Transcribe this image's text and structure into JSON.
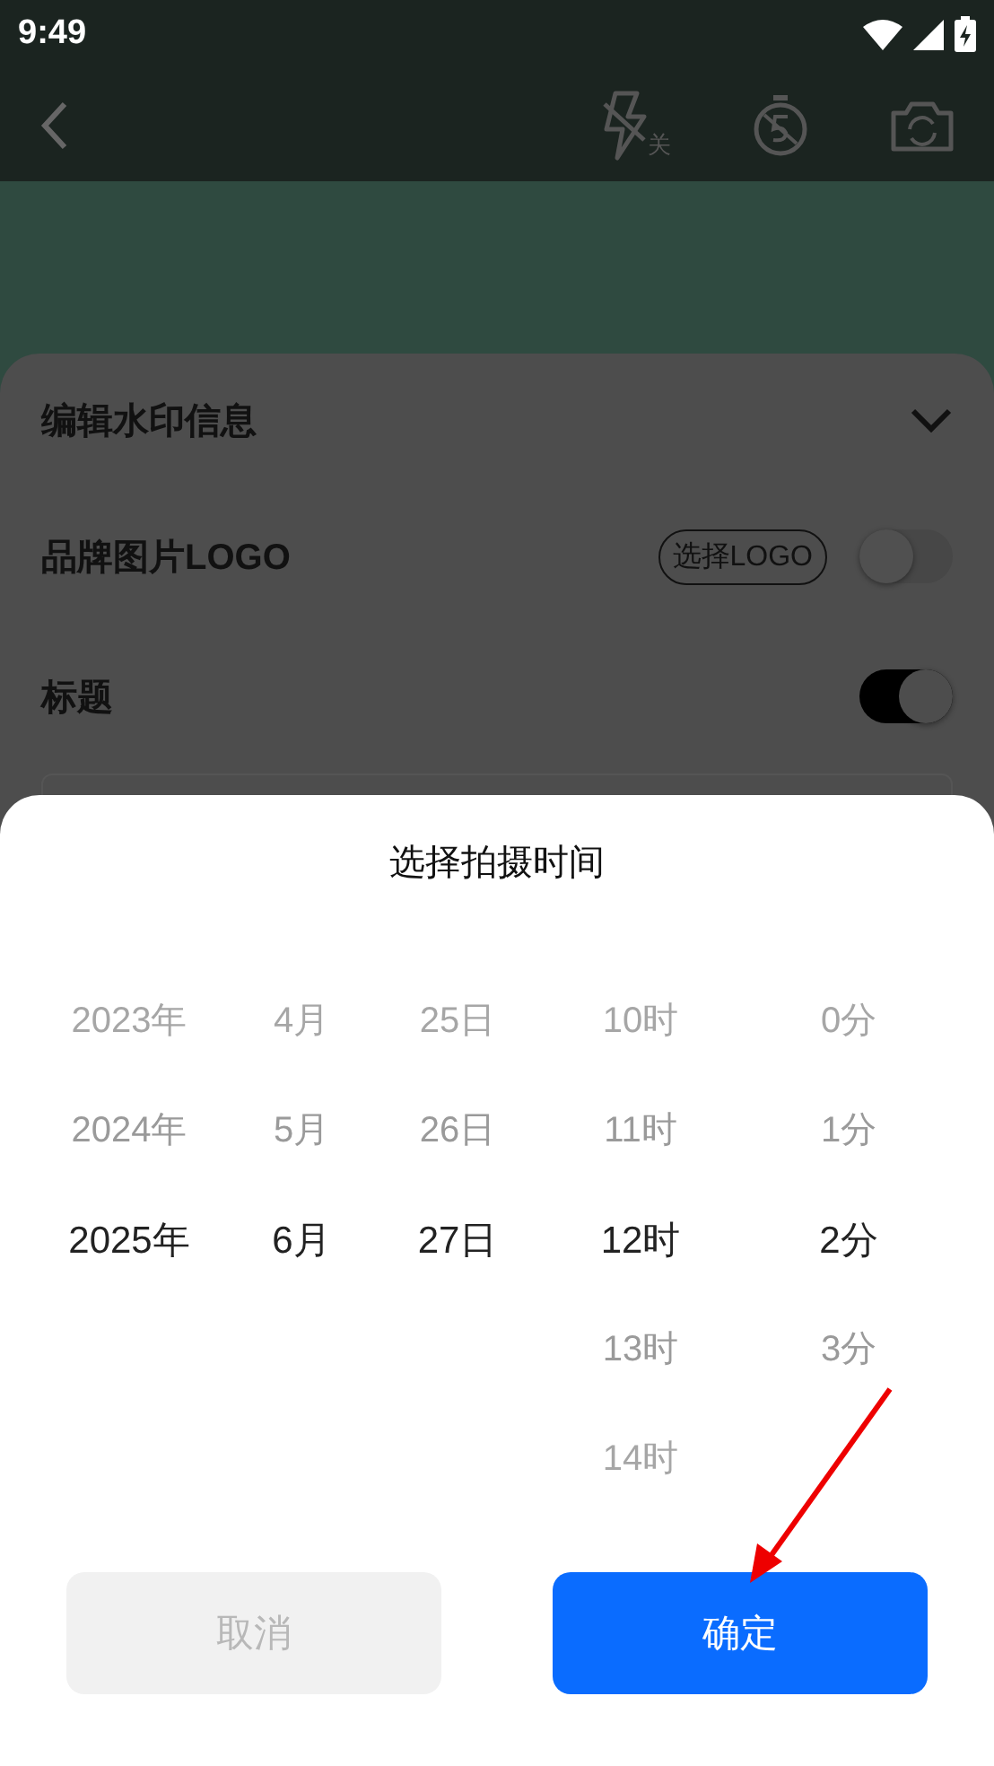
{
  "status_bar": {
    "time": "9:49"
  },
  "camera_toolbar": {
    "flash_label": "关"
  },
  "watermark_panel": {
    "title": "编辑水印信息",
    "expanded": true,
    "rows": [
      {
        "kind": "toggle",
        "label": "品牌图片LOGO",
        "button": "选择LOGO",
        "on": false
      },
      {
        "kind": "toggle",
        "label": "标题",
        "on": true
      }
    ]
  },
  "time_picker": {
    "title": "选择拍摄时间",
    "columns": [
      {
        "items": [
          {
            "text": "2023年",
            "selected": false
          },
          {
            "text": "2024年",
            "selected": false
          },
          {
            "text": "2025年",
            "selected": true
          }
        ]
      },
      {
        "items": [
          {
            "text": "4月",
            "selected": false
          },
          {
            "text": "5月",
            "selected": false
          },
          {
            "text": "6月",
            "selected": true
          }
        ]
      },
      {
        "items": [
          {
            "text": "25日",
            "selected": false
          },
          {
            "text": "26日",
            "selected": false
          },
          {
            "text": "27日",
            "selected": true
          }
        ]
      },
      {
        "items": [
          {
            "text": "10时",
            "selected": false
          },
          {
            "text": "11时",
            "selected": false
          },
          {
            "text": "12时",
            "selected": true
          },
          {
            "text": "13时",
            "selected": false
          },
          {
            "text": "14时",
            "selected": false
          }
        ]
      },
      {
        "items": [
          {
            "text": "0分",
            "selected": false
          },
          {
            "text": "1分",
            "selected": false
          },
          {
            "text": "2分",
            "selected": true
          },
          {
            "text": "3分",
            "selected": false
          }
        ]
      }
    ],
    "buttons": [
      {
        "kind": "cancel",
        "label": "取消"
      },
      {
        "kind": "confirm",
        "label": "确定"
      }
    ]
  }
}
